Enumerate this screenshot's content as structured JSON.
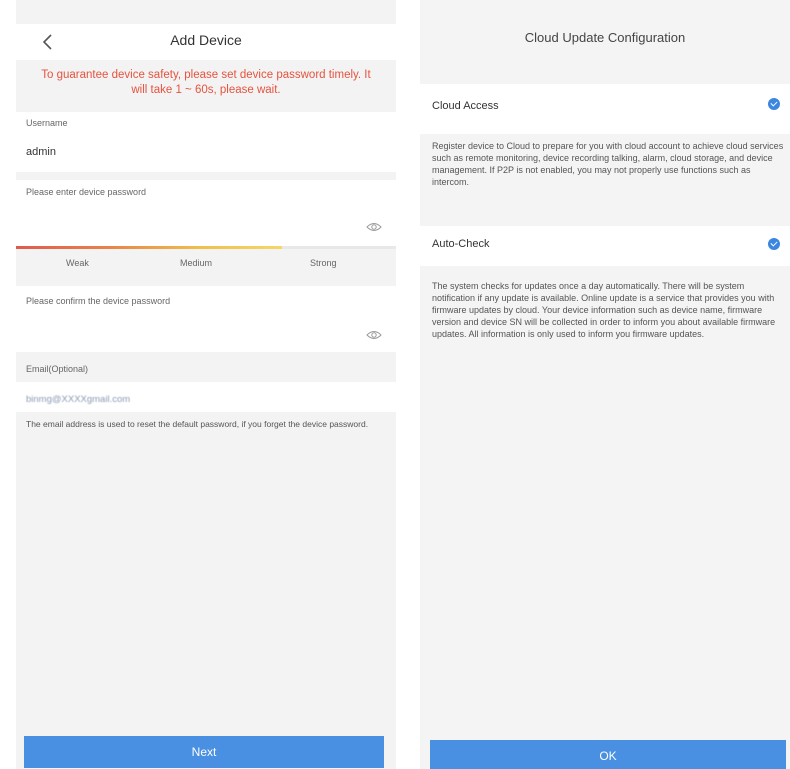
{
  "left": {
    "nav": {
      "title": "Add Device"
    },
    "warning": "To guarantee device safety, please set device password timely. It will take 1 ~ 60s, please wait.",
    "username": {
      "label": "Username",
      "value": "admin"
    },
    "password": {
      "placeholder": "Please enter device password",
      "strength_fill": 0.7,
      "strength_labels": [
        "Weak",
        "Medium",
        "Strong"
      ]
    },
    "confirm": {
      "placeholder": "Please confirm the device password"
    },
    "email": {
      "label": "Email(Optional)",
      "value": "binmg@XXXXgmail.com",
      "description": "The email address is used to reset the default password, if you forget the device password."
    },
    "next_label": "Next"
  },
  "right": {
    "title": "Cloud Update Configuration",
    "cloud_access": {
      "title": "Cloud Access",
      "checked": true,
      "description": "Register device to Cloud to prepare for you with cloud account to achieve cloud services such as remote monitoring, device recording talking, alarm, cloud storage, and device management. If P2P is not enabled, you may not properly use functions such as intercom."
    },
    "auto_check": {
      "title": "Auto-Check",
      "checked": true,
      "description": "The system checks for updates once a day automatically. There will be system notification if any update is available. Online update is a service that provides you with firmware updates by cloud. Your device information such as device name, firmware version and device SN will be collected in order to inform you about available firmware updates. All information is only used to inform you firmware updates."
    },
    "ok_label": "OK"
  },
  "colors": {
    "accent": "#4a90e2",
    "warning": "#e6533f",
    "check": "#3a86e0"
  }
}
